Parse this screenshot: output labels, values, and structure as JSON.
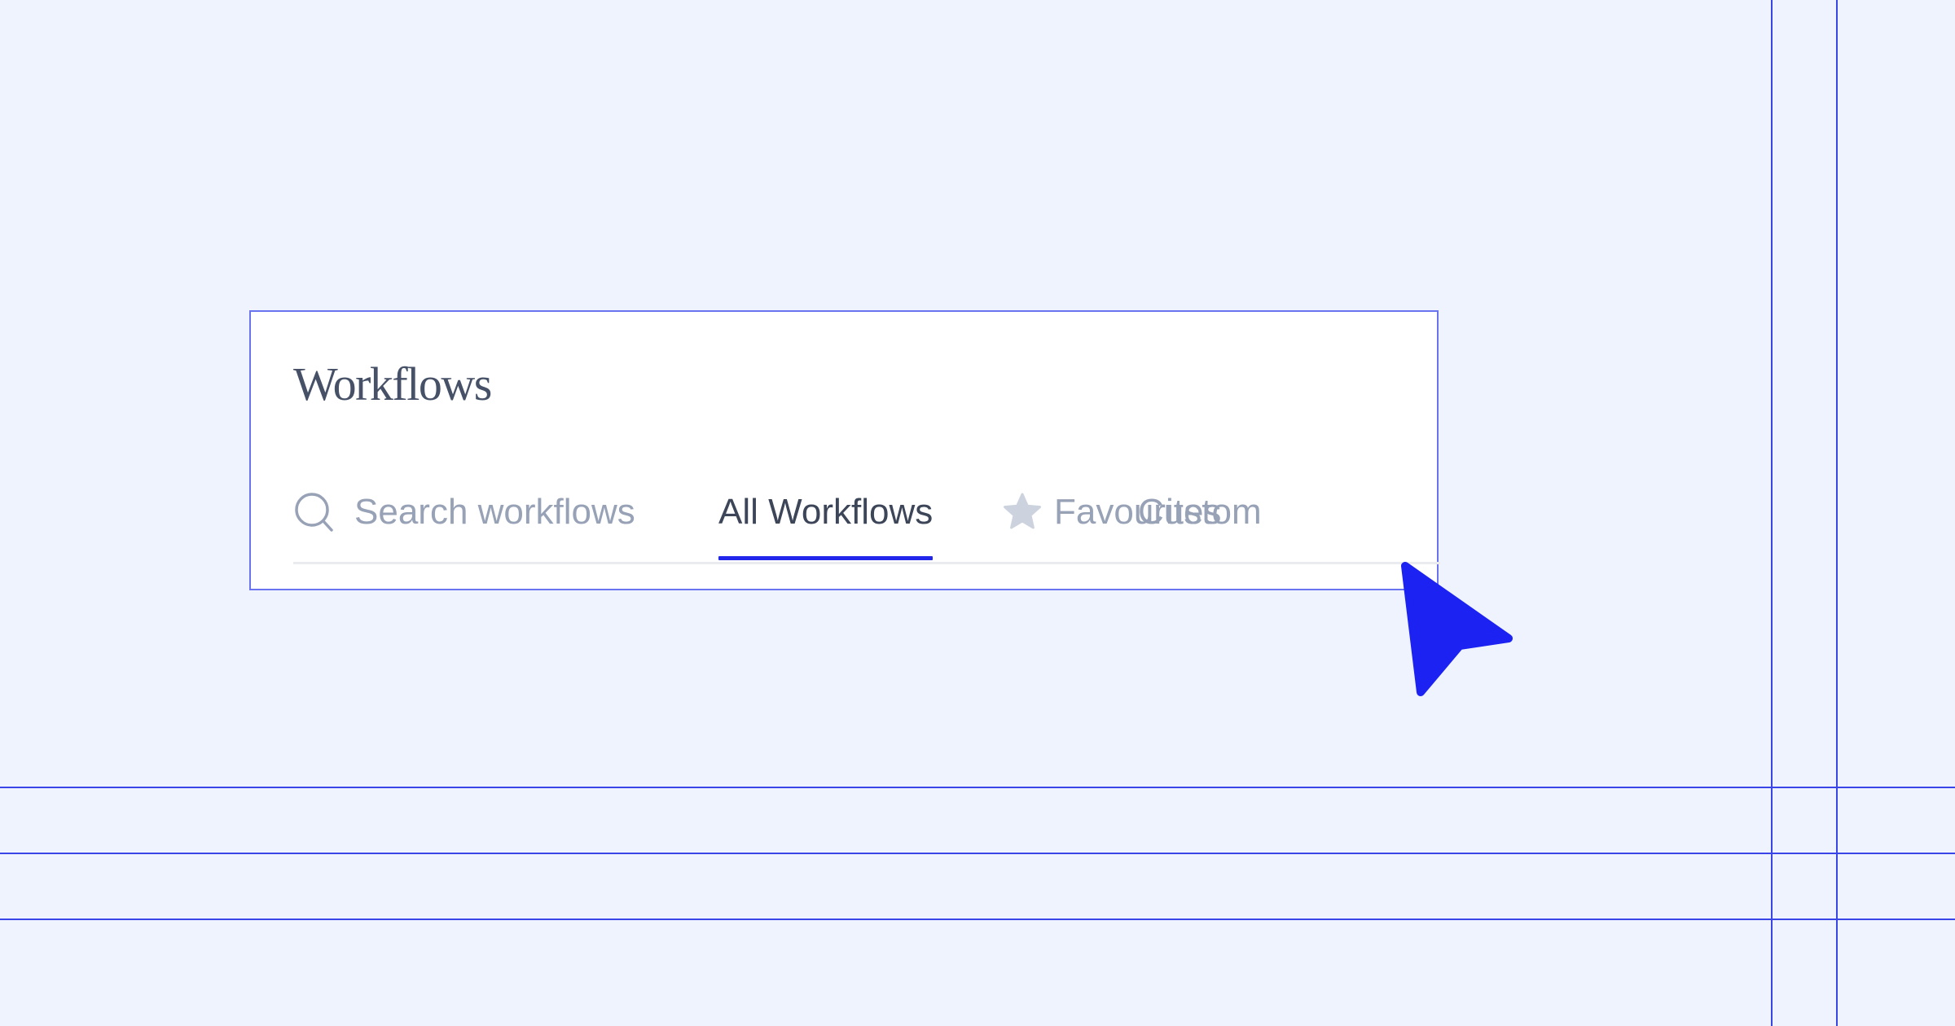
{
  "header": {
    "title": "Workflows"
  },
  "search": {
    "placeholder": "Search workflows",
    "icon": "search-icon"
  },
  "tabs": [
    {
      "label": "All Workflows",
      "active": true
    },
    {
      "label": "Favourites",
      "icon": "star-icon",
      "active": false
    },
    {
      "label": "Custom",
      "active": false
    }
  ],
  "colors": {
    "background": "#eef3fe",
    "accent": "#2226ea",
    "active_text": "#3c4658",
    "inactive_text": "#98a2b6",
    "guide": "#3a45e8"
  }
}
